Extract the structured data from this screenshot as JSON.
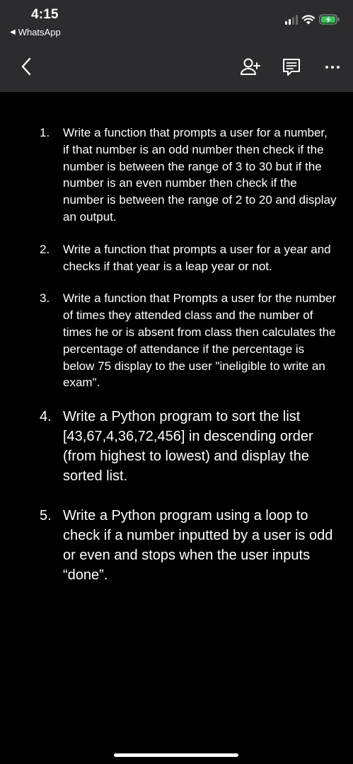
{
  "status_bar": {
    "time": "4:15",
    "back_app_label": "WhatsApp"
  },
  "toolbar": {
    "back_icon": "chevron-left-icon",
    "add_person_icon": "add-person-icon",
    "comment_icon": "comment-icon",
    "more_icon": "more-dots-icon"
  },
  "document": {
    "items": [
      {
        "number": "1.",
        "text": "Write a function that prompts a user for a number, if that number is an odd number then check if the number is between the range of 3 to 30 but if the number is an even number then check if the number is between the range of 2 to 20 and display an output."
      },
      {
        "number": "2.",
        "text": "Write a function that prompts a user for a year and checks if that year is a leap year or not."
      },
      {
        "number": "3.",
        "text": "Write a function that Prompts a user for the number of times they attended class and the number of times he or is absent from class then calculates the percentage of attendance if the percentage is below 75 display to the user \"ineligible to write an exam\"."
      },
      {
        "number": "4.",
        "text": "Write a Python program to sort the list [43,67,4,36,72,456] in descending order (from highest to lowest) and display the sorted list."
      },
      {
        "number": "5.",
        "text": "Write a Python program using a loop to check if a number inputted by a user is odd or even and stops when the user inputs “done”."
      }
    ]
  },
  "colors": {
    "toolbar_bg": "#2c2c2e",
    "page_bg": "#000000",
    "text": "#ffffff",
    "battery_charging": "#34c759"
  }
}
